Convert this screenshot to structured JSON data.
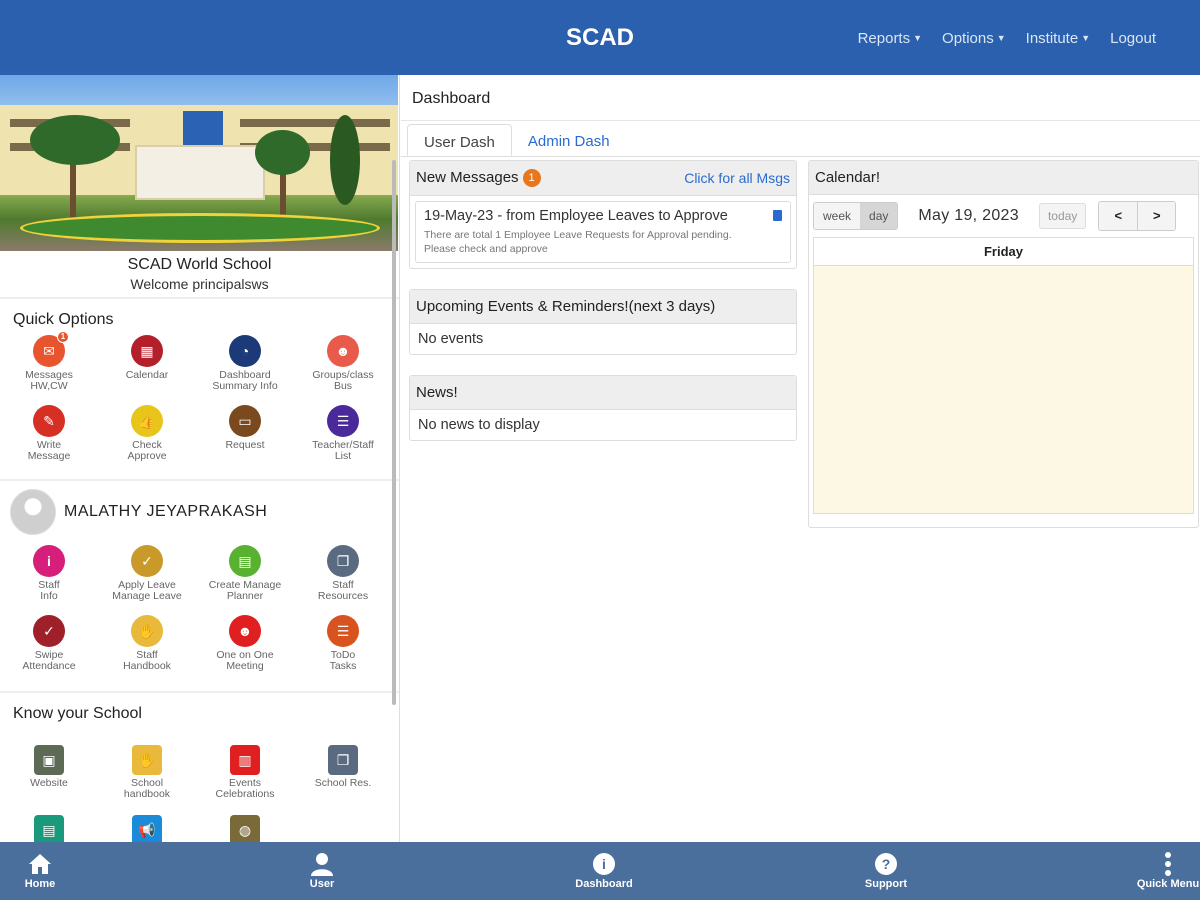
{
  "header": {
    "title": "SCAD",
    "nav": [
      "Reports",
      "Options",
      "Institute",
      "Logout"
    ]
  },
  "sidebar": {
    "school_name": "SCAD World School",
    "welcome": "Welcome principalsws",
    "quick_options_title": "Quick Options",
    "quick_options": [
      {
        "label": "Messages\nHW,CW",
        "color": "#e8542d",
        "icon": "envelope-icon",
        "badge": "1"
      },
      {
        "label": "Calendar",
        "color": "#b3202a",
        "icon": "calendar-icon"
      },
      {
        "label": "Dashboard\nSummary Info",
        "color": "#1c3a78",
        "icon": "pie-chart-icon"
      },
      {
        "label": "Groups/class\nBus",
        "color": "#e85a4a",
        "icon": "group-icon"
      },
      {
        "label": "Write\nMessage",
        "color": "#d63025",
        "icon": "pencil-icon"
      },
      {
        "label": "Check\nApprove",
        "color": "#e8c51a",
        "icon": "thumbs-up-icon"
      },
      {
        "label": "Request",
        "color": "#7a4a1e",
        "icon": "ticket-icon"
      },
      {
        "label": "Teacher/Staff\nList",
        "color": "#4a2a9a",
        "icon": "contacts-icon"
      }
    ],
    "user_name": "MALATHY JEYAPRAKASH",
    "staff_options": [
      {
        "label": "Staff\nInfo",
        "color": "#d61f7a",
        "icon": "info-icon"
      },
      {
        "label": "Apply Leave\nManage Leave",
        "color": "#c99a2a",
        "icon": "clipboard-icon"
      },
      {
        "label": "Create Manage\nPlanner",
        "color": "#59b130",
        "icon": "planner-icon"
      },
      {
        "label": "Staff\nResources",
        "color": "#5a6a80",
        "icon": "copy-icon"
      },
      {
        "label": "Swipe\nAttendance",
        "color": "#a0202a",
        "icon": "check-calendar-icon"
      },
      {
        "label": "Staff\nHandbook",
        "color": "#e8b93a",
        "icon": "handshake-icon"
      },
      {
        "label": "One on One\nMeeting",
        "color": "#e02020",
        "icon": "meeting-icon"
      },
      {
        "label": "ToDo\nTasks",
        "color": "#d9531e",
        "icon": "list-icon"
      }
    ],
    "know_title": "Know your School",
    "know_options": [
      {
        "label": "Website",
        "color": "#5d6a55",
        "icon": "website-icon"
      },
      {
        "label": "School\nhandbook",
        "color": "#e8b93a",
        "icon": "handshake-icon"
      },
      {
        "label": "Events\nCelebrations",
        "color": "#e02020",
        "icon": "events-icon"
      },
      {
        "label": "School Res.",
        "color": "#5a6a80",
        "icon": "copy-icon"
      },
      {
        "label": "",
        "color": "#1a9a7a",
        "icon": "table-icon"
      },
      {
        "label": "",
        "color": "#1a8ad9",
        "icon": "megaphone-icon"
      },
      {
        "label": "",
        "color": "#7a6a3a",
        "icon": "globe-icon"
      }
    ]
  },
  "main": {
    "title": "Dashboard",
    "tabs": [
      "User Dash",
      "Admin Dash"
    ],
    "messages": {
      "title": "New Messages",
      "count": "1",
      "link": "Click for all Msgs",
      "item_title": "19-May-23 - from Employee Leaves to Approve",
      "item_body": "There are total 1 Employee Leave Requests for Approval pending. Please check and approve"
    },
    "events": {
      "title": "Upcoming Events & Reminders!(next 3 days)",
      "body": "No events"
    },
    "news": {
      "title": "News!",
      "body": "No news to display"
    },
    "calendar": {
      "title": "Calendar!",
      "view_week": "week",
      "view_day": "day",
      "date": "May 19, 2023",
      "today": "today",
      "prev": "<",
      "next": ">",
      "day_header": "Friday"
    }
  },
  "bottom_nav": [
    {
      "label": "Home",
      "icon": "home-icon"
    },
    {
      "label": "User",
      "icon": "user-icon"
    },
    {
      "label": "Dashboard",
      "icon": "info-icon"
    },
    {
      "label": "Support",
      "icon": "help-icon"
    },
    {
      "label": "Quick Menu",
      "icon": "kebab-menu-icon"
    }
  ]
}
